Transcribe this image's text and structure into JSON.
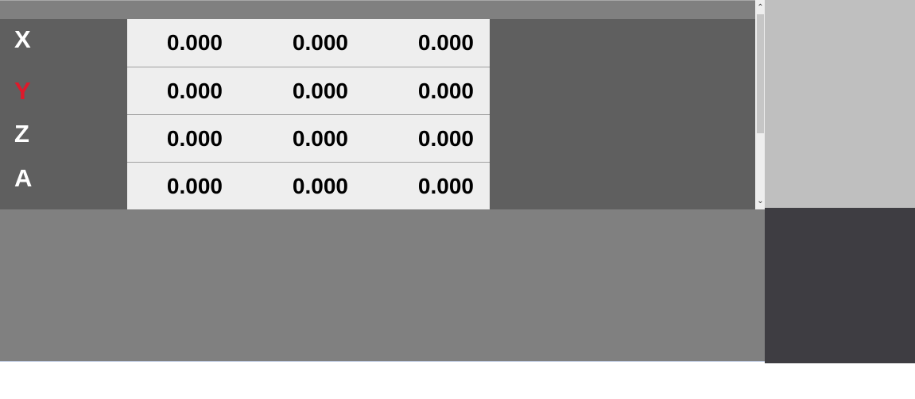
{
  "axes": [
    {
      "label": "X",
      "values": [
        "0.000",
        "0.000",
        "0.000"
      ]
    },
    {
      "label": "Y",
      "values": [
        "0.000",
        "0.000",
        "0.000"
      ],
      "highlight": true
    },
    {
      "label": "Z",
      "values": [
        "0.000",
        "0.000",
        "0.000"
      ]
    },
    {
      "label": "A",
      "values": [
        "0.000",
        "0.000",
        "0.000"
      ]
    }
  ],
  "colors": {
    "highlight_axis": "#dd1a2b",
    "panel_bg": "#808080",
    "dro_bg": "#5f5f5f",
    "value_bg": "#eeeeee",
    "right_panel_top": "#bfbfbf",
    "right_panel_bottom": "#3e3d42"
  },
  "scrollbar": {
    "up_icon": "chevron-up-icon",
    "down_icon": "chevron-down-icon"
  }
}
